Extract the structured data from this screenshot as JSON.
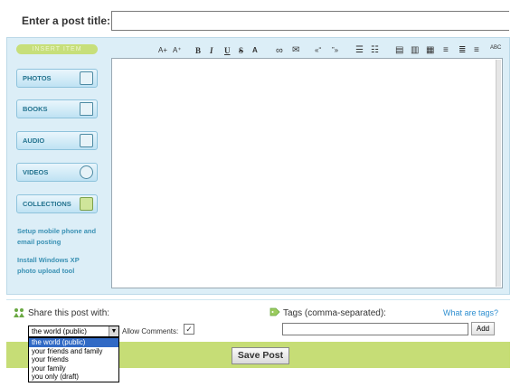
{
  "post": {
    "title_label": "Enter a post title:",
    "title_value": ""
  },
  "sidebar": {
    "insert_label": "INSERT ITEM",
    "buttons": [
      {
        "label": "PHOTOS",
        "icon": "photos-icon"
      },
      {
        "label": "BOOKS",
        "icon": "books-icon"
      },
      {
        "label": "AUDIO",
        "icon": "audio-icon"
      },
      {
        "label": "VIDEOS",
        "icon": "videos-icon"
      },
      {
        "label": "COLLECTIONS",
        "icon": "collections-icon"
      }
    ],
    "links": [
      "Setup mobile phone and email posting",
      "Install Windows XP photo upload tool"
    ]
  },
  "toolbar": {
    "items": [
      {
        "name": "increase-font-size",
        "glyph": "A+"
      },
      {
        "name": "decrease-font-size",
        "glyph": "A⁺"
      },
      {
        "name": "bold",
        "glyph": "B"
      },
      {
        "name": "italic",
        "glyph": "I"
      },
      {
        "name": "underline",
        "glyph": "U"
      },
      {
        "name": "strikethrough",
        "glyph": "S"
      },
      {
        "name": "text-color",
        "glyph": "A"
      },
      {
        "name": "link",
        "glyph": "∞"
      },
      {
        "name": "email",
        "glyph": "✉"
      },
      {
        "name": "open-quote",
        "glyph": "«“"
      },
      {
        "name": "close-quote",
        "glyph": "”»"
      },
      {
        "name": "bulleted-list",
        "glyph": "☰"
      },
      {
        "name": "numbered-list",
        "glyph": "☷"
      },
      {
        "name": "image-left",
        "glyph": "▤"
      },
      {
        "name": "image-center",
        "glyph": "▥"
      },
      {
        "name": "image-right",
        "glyph": "▦"
      },
      {
        "name": "align-left",
        "glyph": "≡"
      },
      {
        "name": "align-center",
        "glyph": "≣"
      },
      {
        "name": "align-right",
        "glyph": "≡"
      },
      {
        "name": "spell-check",
        "glyph": "ABC"
      }
    ]
  },
  "editor": {
    "content": ""
  },
  "share": {
    "label": "Share this post with:",
    "selected": "the world (public)",
    "options": [
      "the world (public)",
      "your friends and family",
      "your friends",
      "your family",
      "you only (draft)"
    ],
    "allow_comments_label": "Allow Comments:",
    "allow_comments_checked": true
  },
  "tags": {
    "label": "Tags (comma-separated):",
    "help_link": "What are tags?",
    "value": "",
    "add_label": "Add"
  },
  "actions": {
    "save_label": "Save Post"
  },
  "colors": {
    "panel_bg": "#dceef7",
    "accent_green": "#c6dd76",
    "link_blue": "#3a91b4",
    "select_highlight": "#316ac5"
  }
}
